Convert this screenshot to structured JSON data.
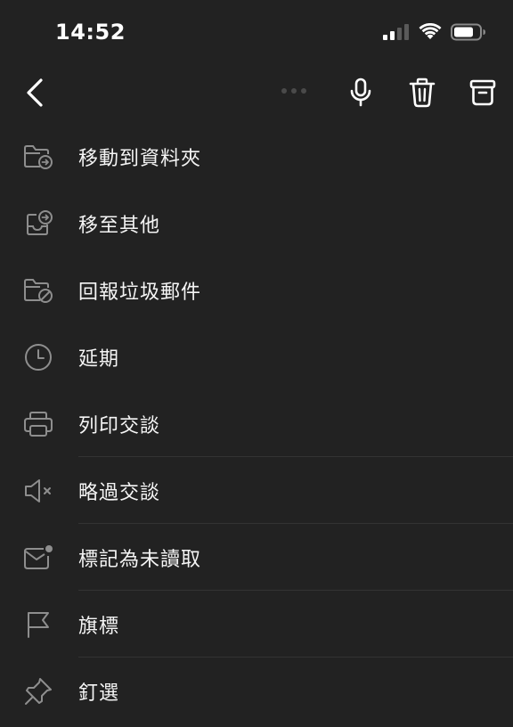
{
  "status_bar": {
    "time": "14:52",
    "icons": [
      "signal-icon",
      "wifi-icon",
      "battery-icon"
    ]
  },
  "toolbar": {
    "back_icon": "chevron-left-icon",
    "actions": [
      "microphone-icon",
      "trash-icon",
      "archive-icon"
    ]
  },
  "colors": {
    "background": "#222222",
    "icon_gray": "#8e8e8e",
    "text": "#f5f5f5"
  },
  "menu": {
    "items": [
      {
        "label": "移動到資料夾",
        "icon": "folder-move-icon"
      },
      {
        "label": "移至其他",
        "icon": "inbox-move-icon"
      },
      {
        "label": "回報垃圾郵件",
        "icon": "folder-block-icon"
      },
      {
        "label": "延期",
        "icon": "clock-icon"
      },
      {
        "label": "列印交談",
        "icon": "printer-icon"
      },
      {
        "label": "略過交談",
        "icon": "speaker-mute-icon"
      },
      {
        "label": "標記為未讀取",
        "icon": "mail-unread-icon"
      },
      {
        "label": "旗標",
        "icon": "flag-icon"
      },
      {
        "label": "釘選",
        "icon": "pin-icon"
      }
    ]
  }
}
